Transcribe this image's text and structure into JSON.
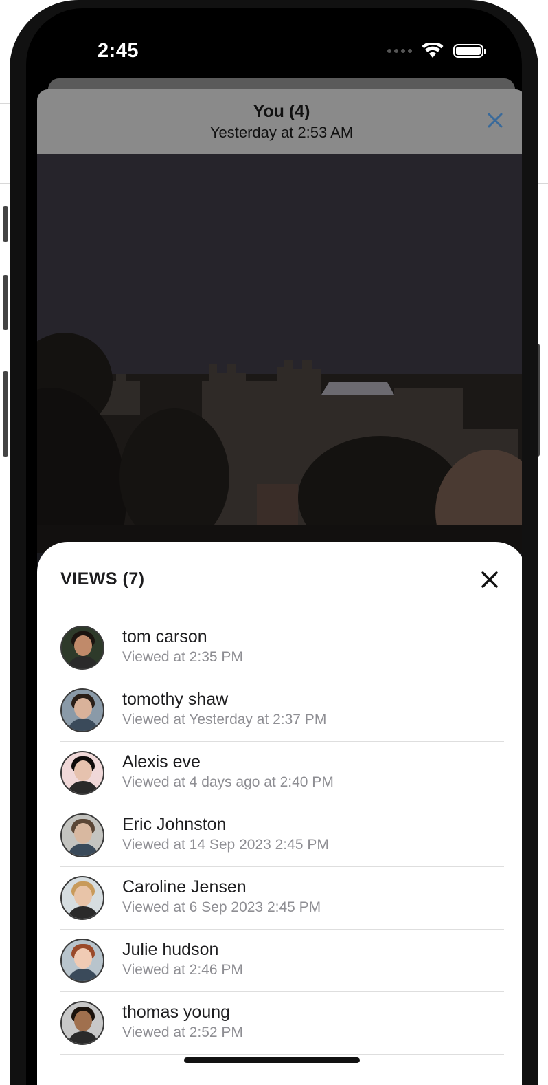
{
  "status_bar": {
    "time": "2:45"
  },
  "story": {
    "title": "You (4)",
    "subtitle": "Yesterday at 2:53 AM"
  },
  "views_sheet": {
    "title": "VIEWS (7)",
    "viewers": [
      {
        "name": "tom carson",
        "time": "Viewed at 2:35 PM",
        "skin": "#c08a6a",
        "hair": "#1b1410",
        "bg": "#2e3a2a"
      },
      {
        "name": "tomothy shaw",
        "time": "Viewed at Yesterday at 2:37 PM",
        "skin": "#d9b29a",
        "hair": "#2a1f18",
        "bg": "#8a9aa8"
      },
      {
        "name": "Alexis eve",
        "time": "Viewed at 4 days ago at 2:40 PM",
        "skin": "#e6c2ae",
        "hair": "#0e0b0a",
        "bg": "#f0d8d8"
      },
      {
        "name": "Eric Johnston",
        "time": "Viewed at 14 Sep 2023 2:45 PM",
        "skin": "#d8b8a0",
        "hair": "#5a4636",
        "bg": "#c4c4c0"
      },
      {
        "name": "Caroline Jensen",
        "time": "Viewed at 6 Sep 2023 2:45 PM",
        "skin": "#e8c4a8",
        "hair": "#c89a5a",
        "bg": "#d6dde0"
      },
      {
        "name": "Julie hudson",
        "time": "Viewed at 2:46 PM",
        "skin": "#f0cbb4",
        "hair": "#9a4a2a",
        "bg": "#b8c4cc"
      },
      {
        "name": "thomas young",
        "time": "Viewed at 2:52 PM",
        "skin": "#a0704e",
        "hair": "#1a120c",
        "bg": "#c8c8c8"
      }
    ]
  }
}
